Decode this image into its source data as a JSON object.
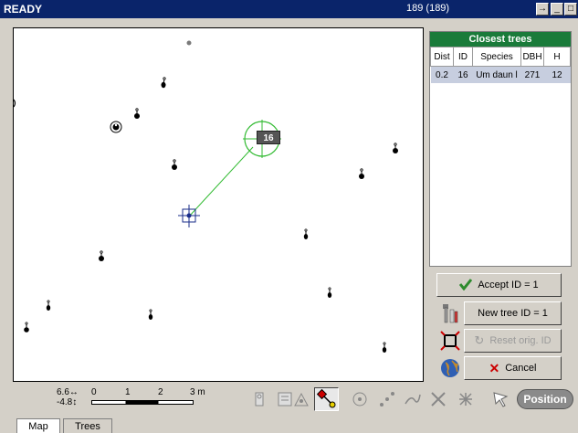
{
  "titlebar": {
    "status": "READY",
    "count": "189 (189)",
    "btn_arrow": "→",
    "btn_min": "_",
    "btn_max": "□"
  },
  "closest_trees": {
    "title": "Closest trees",
    "columns": [
      "Dist",
      "ID",
      "Species",
      "DBH",
      "H"
    ],
    "rows": [
      {
        "dist": "0.2",
        "id": "16",
        "species": "Um daun l",
        "dbh": "271",
        "h": "12"
      }
    ]
  },
  "map": {
    "selected_label": "16"
  },
  "buttons": {
    "accept": "Accept ID = 1",
    "new_tree": "New tree ID = 1",
    "reset": "Reset orig. ID",
    "cancel": "Cancel",
    "position": "Position"
  },
  "scale": {
    "x_offset": "6.6↔",
    "y_offset": "-4.8↕",
    "ticks": [
      "0",
      "1",
      "2",
      "3 m"
    ]
  },
  "tabs": [
    "Map",
    "Trees"
  ],
  "colors": {
    "titlebar": "#0a246a",
    "panel_header": "#1a7b3a",
    "selected_row": "#c7cedf",
    "accept_check": "#2e8b2e",
    "cancel_x": "#cc0000",
    "circle": "#33bb33"
  }
}
